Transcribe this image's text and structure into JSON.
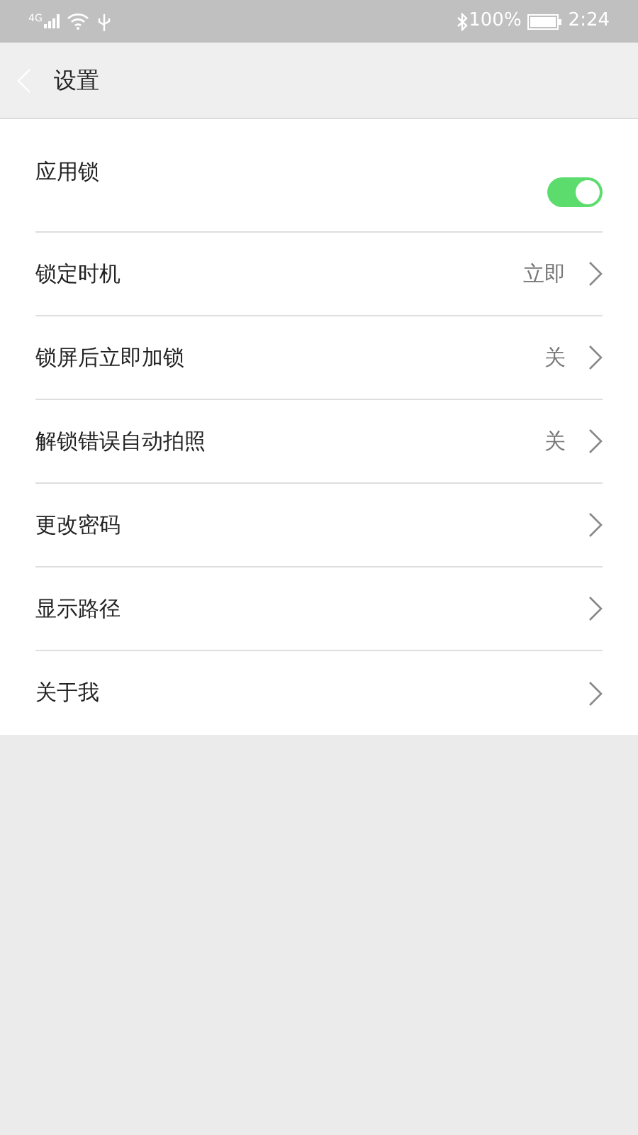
{
  "status_bar": {
    "network": "4G",
    "battery": "100%",
    "time": "2:24"
  },
  "header": {
    "title": "设置"
  },
  "items": [
    {
      "kind": "toggle",
      "label": "应用锁",
      "on": true
    },
    {
      "kind": "link",
      "label": "锁定时机",
      "value": "立即"
    },
    {
      "kind": "link",
      "label": "锁屏后立即加锁",
      "value": "关"
    },
    {
      "kind": "link",
      "label": "解锁错误自动拍照",
      "value": "关"
    },
    {
      "kind": "link",
      "label": "更改密码"
    },
    {
      "kind": "link",
      "label": "显示路径"
    },
    {
      "kind": "link",
      "label": "关于我"
    }
  ]
}
